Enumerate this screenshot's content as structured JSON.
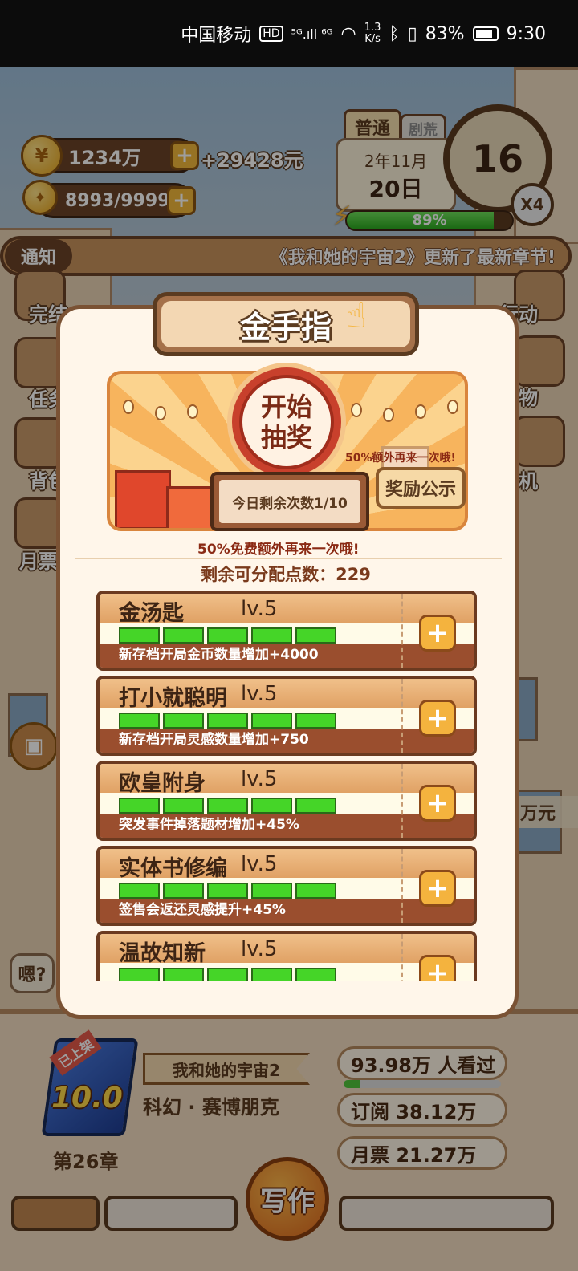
{
  "status_bar": {
    "carrier": "中国移动",
    "hd": "HD",
    "signal": "⁵ᴳ.ıll ⁶ᴳ",
    "speed_top": "1.3",
    "speed_bottom": "K/s",
    "battery": "83%",
    "time": "9:30"
  },
  "hud": {
    "coins": "1234万",
    "income": "+29428元",
    "inspiration": "8993/9999",
    "mode": "普通",
    "mode_secondary": "剧荒",
    "date_year_month": "2年11月",
    "date_day": "20日",
    "clock_value": "16",
    "speed_multiplier": "X4",
    "energy_percent": 89,
    "energy_text": "89%"
  },
  "notice": {
    "tag": "通知",
    "text": "《我和她的宇宙2》更新了最新章节!"
  },
  "side_labels": [
    "完结",
    "任务",
    "背包",
    "月票",
    "行动",
    "购物",
    "手机"
  ],
  "dialog_hint": "嗯?",
  "right_money": "万元",
  "panel": {
    "title": "金手指",
    "draw_button": "开始\n抽奖",
    "draw_remaining": "今日剩余次数1/10",
    "banner_note": "50%额外再来一次哦!",
    "reward_button": "奖励公示",
    "free_note": "50%免费额外再来一次哦!",
    "points_label": "剩余可分配点数：229",
    "skills": [
      {
        "name": "金汤匙",
        "level": "lv.5",
        "filled": 5,
        "total": 5,
        "desc": "新存档开局金币数量增加+4000"
      },
      {
        "name": "打小就聪明",
        "level": "lv.5",
        "filled": 5,
        "total": 5,
        "desc": "新存档开局灵感数量增加+750"
      },
      {
        "name": "欧皇附身",
        "level": "lv.5",
        "filled": 5,
        "total": 5,
        "desc": "突发事件掉落题材增加+45%"
      },
      {
        "name": "实体书修编",
        "level": "lv.5",
        "filled": 5,
        "total": 5,
        "desc": "签售会返还灵感提升+45%"
      },
      {
        "name": "温故知新",
        "level": "lv.5",
        "filled": 5,
        "total": 5,
        "desc": ""
      }
    ]
  },
  "book": {
    "tag": "已上架",
    "score": "10.0",
    "title": "我和她的宇宙2",
    "genre": "科幻 · 赛博朋克",
    "chapter": "第26章",
    "views": "93.98万 人看过",
    "views_progress": 0.1,
    "subscriptions": "订阅  38.12万",
    "monthly_votes": "月票  21.27万"
  },
  "write_button": "写作",
  "colors": {
    "accent": "#f4b33e",
    "panel_border": "#7a5234",
    "bar_green": "#45d528"
  }
}
